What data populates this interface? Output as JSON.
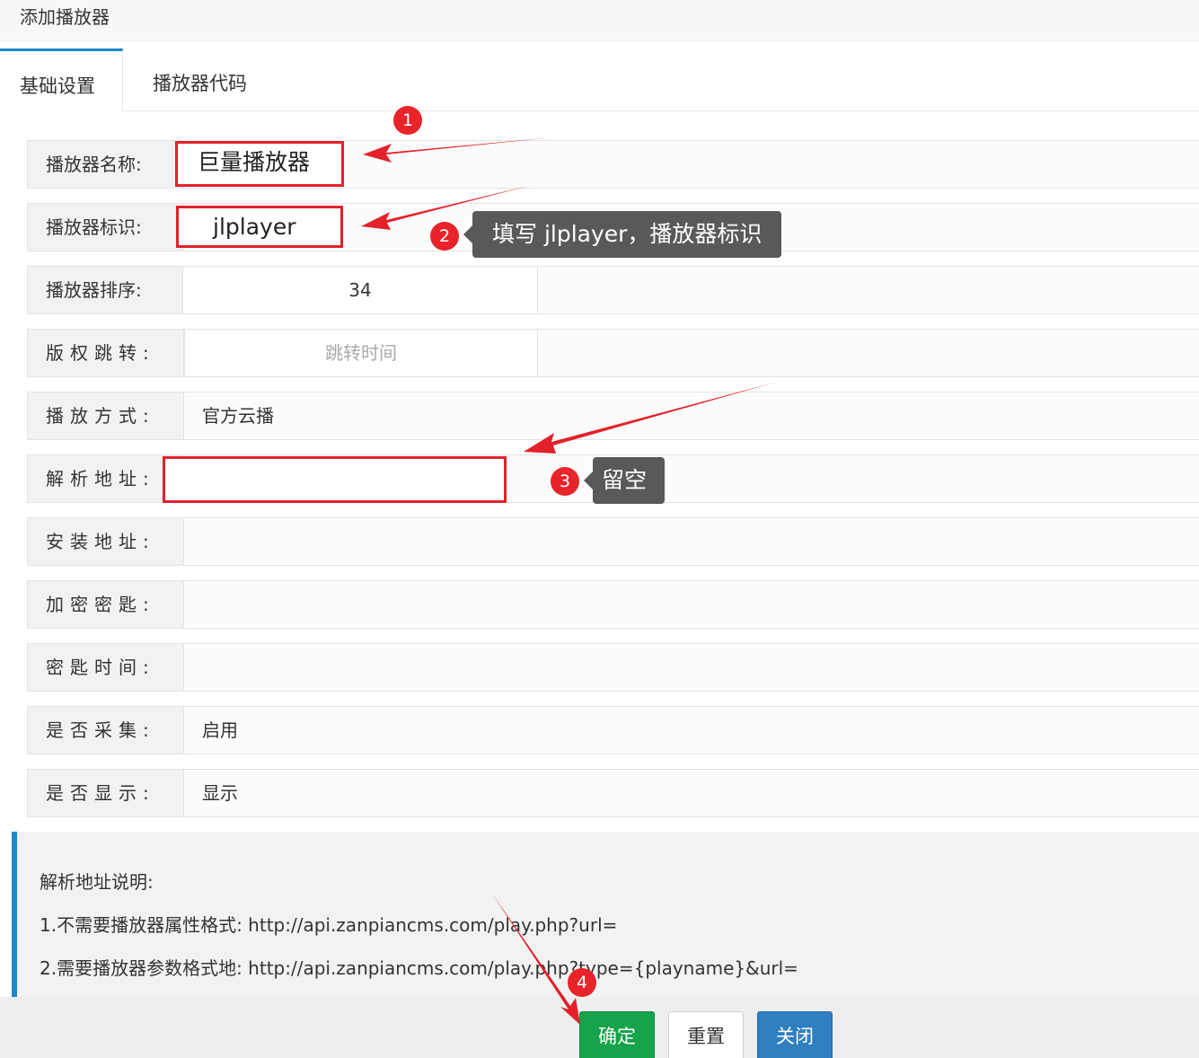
{
  "window": {
    "title": "添加播放器"
  },
  "tabs": [
    {
      "label": "基础设置",
      "active": true
    },
    {
      "label": "播放器代码",
      "active": false
    }
  ],
  "form": {
    "name": {
      "label": "播放器名称:",
      "value": "巨量播放器"
    },
    "ident": {
      "label": "播放器标识:",
      "value": "jlplayer"
    },
    "order": {
      "label": "播放器排序:",
      "value": "34"
    },
    "jump": {
      "label": "版权跳转:",
      "placeholder": "跳转时间"
    },
    "mode": {
      "label": "播放方式:",
      "value": "官方云播"
    },
    "parse": {
      "label": "解析地址:",
      "value": ""
    },
    "install": {
      "label": "安装地址:",
      "value": ""
    },
    "secret": {
      "label": "加密密匙:",
      "value": ""
    },
    "secret_time": {
      "label": "密匙时间:",
      "value": ""
    },
    "collect": {
      "label": "是否采集:",
      "value": "启用"
    },
    "display": {
      "label": "是否显示:",
      "value": "显示"
    }
  },
  "notice": {
    "title": "解析地址说明:",
    "lines": [
      "1.不需要播放器属性格式:  http://api.zanpiancms.com/play.php?url=",
      "2.需要播放器参数格式地:  http://api.zanpiancms.com/play.php?type={playname}&url="
    ]
  },
  "buttons": {
    "ok": "确定",
    "reset": "重置",
    "close": "关闭"
  },
  "annotations": {
    "badges": [
      "1",
      "2",
      "3",
      "4"
    ],
    "tip_ident": "填写 jlplayer，播放器标识",
    "tip_parse": "留空",
    "color": "#e3212a"
  }
}
